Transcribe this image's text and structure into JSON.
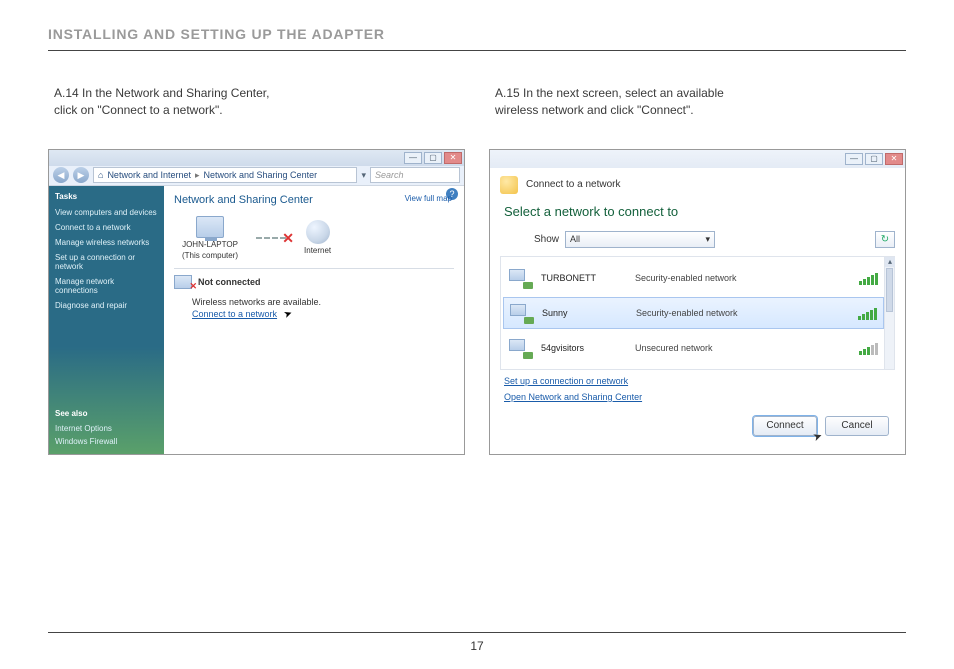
{
  "page": {
    "title": "INSTALLING AND SETTING UP THE ADAPTER",
    "number": "17"
  },
  "left": {
    "caption": "A.14 In the Network and Sharing Center,\n         click on \"Connect to a network\".",
    "breadcrumb": {
      "seg1": "Network and Internet",
      "seg2": "Network and Sharing Center"
    },
    "search_placeholder": "Search",
    "sidebar": {
      "tasks_header": "Tasks",
      "tasks": [
        "View computers and devices",
        "Connect to a network",
        "Manage wireless networks",
        "Set up a connection or network",
        "Manage network connections",
        "Diagnose and repair"
      ],
      "see_also_header": "See also",
      "see_also": [
        "Internet Options",
        "Windows Firewall"
      ]
    },
    "content": {
      "heading": "Network and Sharing Center",
      "view_full_map": "View full map",
      "this_pc": "JOHN-LAPTOP",
      "this_pc_sub": "(This computer)",
      "internet": "Internet",
      "not_connected": "Not connected",
      "wireless_available": "Wireless networks are available.",
      "connect_link": "Connect to a network"
    }
  },
  "right": {
    "caption": "A.15 In the next screen, select an available\n         wireless network and click \"Connect\".",
    "window_title": "Connect to a network",
    "prompt": "Select a network to connect to",
    "show_label": "Show",
    "show_value": "All",
    "networks": [
      {
        "name": "TURBONETT",
        "type": "Security-enabled network",
        "bars_on": 5
      },
      {
        "name": "Sunny",
        "type": "Security-enabled network",
        "bars_on": 5
      },
      {
        "name": "54gvisitors",
        "type": "Unsecured network",
        "bars_on": 3
      }
    ],
    "links": [
      "Set up a connection or network",
      "Open Network and Sharing Center"
    ],
    "buttons": {
      "connect": "Connect",
      "cancel": "Cancel"
    }
  }
}
